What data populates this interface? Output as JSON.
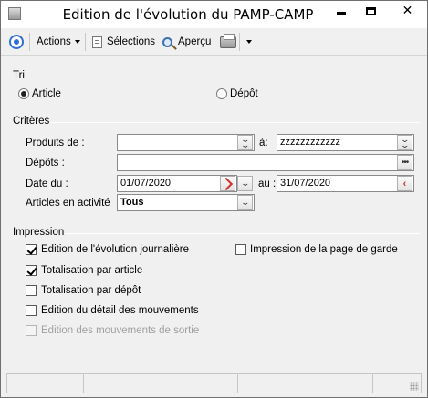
{
  "window": {
    "title": "Edition de l'évolution du PAMP-CAMP"
  },
  "toolbar": {
    "actions": "Actions",
    "selections": "Sélections",
    "apercu": "Aperçu"
  },
  "tri": {
    "label": "Tri",
    "options": [
      {
        "label": "Article",
        "selected": true
      },
      {
        "label": "Dépôt",
        "selected": false
      }
    ]
  },
  "criteres": {
    "label": "Critères",
    "produits_label": "Produits de :",
    "produits_from": "",
    "a_label": "à:",
    "produits_to": "zzzzzzzzzzzz",
    "depots_label": "Dépôts :",
    "depots_value": "",
    "date_label": "Date du :",
    "date_from": "01/07/2020",
    "au_label": "au :",
    "date_to": "31/07/2020",
    "articles_label": "Articles en activité",
    "articles_value": "Tous"
  },
  "impression": {
    "label": "Impression",
    "options": [
      {
        "label": "Edition de l'évolution journalière",
        "checked": true,
        "enabled": true
      },
      {
        "label": "Totalisation par article",
        "checked": true,
        "enabled": true
      },
      {
        "label": "Totalisation par dépôt",
        "checked": false,
        "enabled": true
      },
      {
        "label": "Edition du détail des mouvements",
        "checked": false,
        "enabled": true
      },
      {
        "label": "Edition des mouvements de sortie",
        "checked": false,
        "enabled": false
      },
      {
        "label": "Impression de la page de garde",
        "checked": false,
        "enabled": true
      }
    ]
  }
}
